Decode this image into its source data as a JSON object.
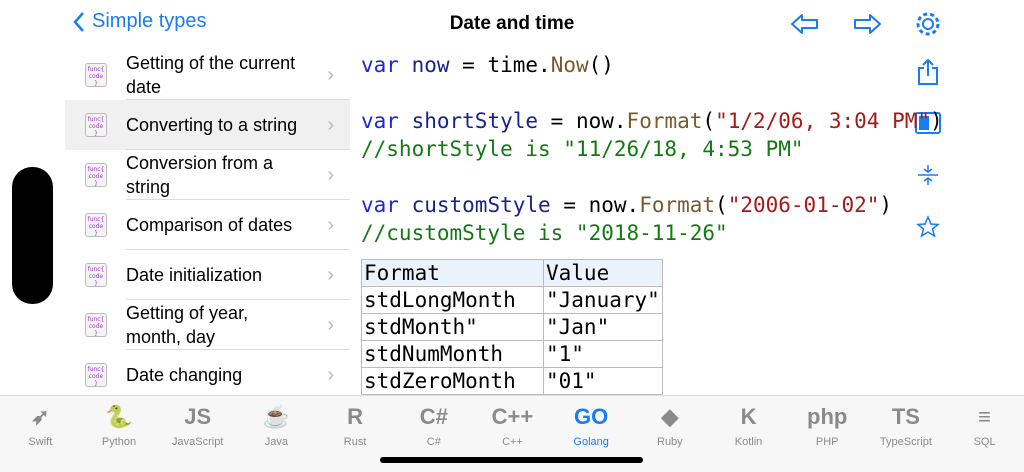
{
  "nav": {
    "back_label": "Simple types",
    "title": "Date and time"
  },
  "sidebar": {
    "items": [
      {
        "label": "Getting of the current date",
        "selected": false
      },
      {
        "label": "Converting to a string",
        "selected": true
      },
      {
        "label": "Conversion from a string",
        "selected": false
      },
      {
        "label": "Comparison of dates",
        "selected": false
      },
      {
        "label": "Date initialization",
        "selected": false
      },
      {
        "label": "Getting of year, month, day",
        "selected": false
      },
      {
        "label": "Date changing",
        "selected": false
      }
    ],
    "item_icon": "func-code-icon"
  },
  "code": {
    "l1": {
      "kw": "var",
      "id": "now",
      "eq": " = time.",
      "fn": "Now",
      "rest": "()"
    },
    "l2": {
      "kw": "var",
      "id": "shortStyle",
      "eq": " = now.",
      "fn": "Format",
      "open": "(",
      "str": "\"1/2/06, 3:04 PM\"",
      "close": ")"
    },
    "l3": "//shortStyle is \"11/26/18, 4:53 PM\"",
    "l4": {
      "kw": "var",
      "id": "customStyle",
      "eq": " = now.",
      "fn": "Format",
      "open": "(",
      "str": "\"2006-01-02\"",
      "close": ")"
    },
    "l5": "//customStyle is \"2018-11-26\""
  },
  "table": {
    "headers": [
      "Format",
      "Value"
    ],
    "rows": [
      [
        "stdLongMonth",
        "\"January\""
      ],
      [
        "stdMonth\"",
        "\"Jan\""
      ],
      [
        "stdNumMonth",
        "\"1\""
      ],
      [
        "stdZeroMonth",
        "\"01\""
      ]
    ]
  },
  "tabs": [
    {
      "label": "Swift",
      "glyph": "➶"
    },
    {
      "label": "Python",
      "glyph": "🐍"
    },
    {
      "label": "JavaScript",
      "glyph": "JS"
    },
    {
      "label": "Java",
      "glyph": "☕"
    },
    {
      "label": "Rust",
      "glyph": "R"
    },
    {
      "label": "C#",
      "glyph": "C#"
    },
    {
      "label": "C++",
      "glyph": "C++"
    },
    {
      "label": "Golang",
      "glyph": "GO",
      "active": true
    },
    {
      "label": "Ruby",
      "glyph": "◆"
    },
    {
      "label": "Kotlin",
      "glyph": "K"
    },
    {
      "label": "PHP",
      "glyph": "php"
    },
    {
      "label": "TypeScript",
      "glyph": "TS"
    },
    {
      "label": "SQL",
      "glyph": "≡"
    }
  ],
  "colors": {
    "accent": "#1a7cf5",
    "keyword": "#1c2ad6",
    "string": "#a51a1a",
    "comment": "#137a13",
    "function": "#7a5a2a"
  }
}
